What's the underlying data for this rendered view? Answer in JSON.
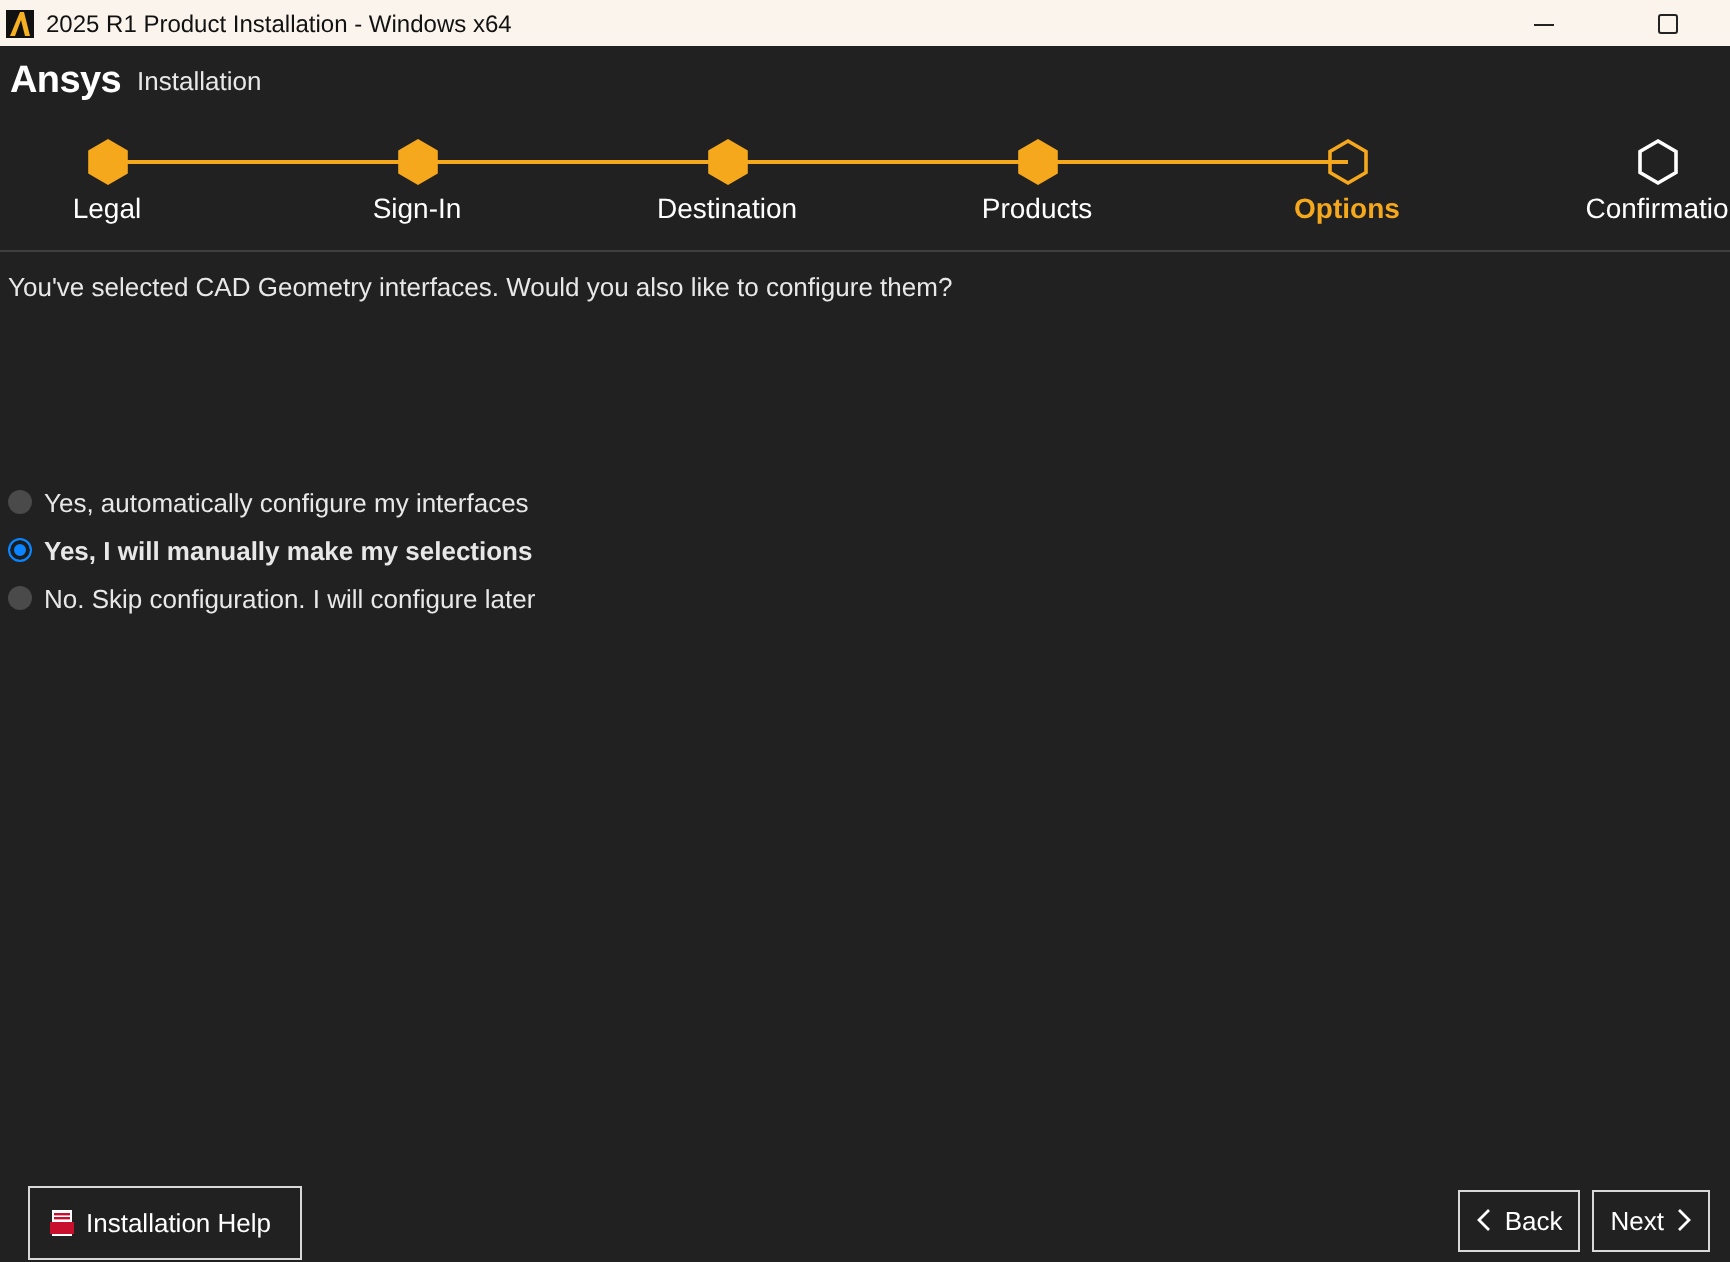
{
  "window": {
    "title": "2025 R1 Product Installation - Windows x64"
  },
  "header": {
    "brand": "Ansys",
    "subtitle": "Installation"
  },
  "steps": [
    {
      "label": "Legal",
      "completed": true,
      "selected": false
    },
    {
      "label": "Sign-In",
      "completed": true,
      "selected": false
    },
    {
      "label": "Destination",
      "completed": true,
      "selected": false
    },
    {
      "label": "Products",
      "completed": true,
      "selected": false
    },
    {
      "label": "Options",
      "completed": false,
      "selected": true
    },
    {
      "label": "Confirmatio",
      "completed": false,
      "selected": false
    }
  ],
  "question": "You've selected CAD Geometry interfaces. Would you also like to configure them?",
  "options": [
    {
      "label": "Yes, automatically configure my interfaces",
      "selected": false
    },
    {
      "label": "Yes, I will manually make my selections",
      "selected": true
    },
    {
      "label": "No. Skip configuration. I will configure later",
      "selected": false
    }
  ],
  "footer": {
    "help": "Installation Help",
    "back": "Back",
    "next": "Next"
  }
}
